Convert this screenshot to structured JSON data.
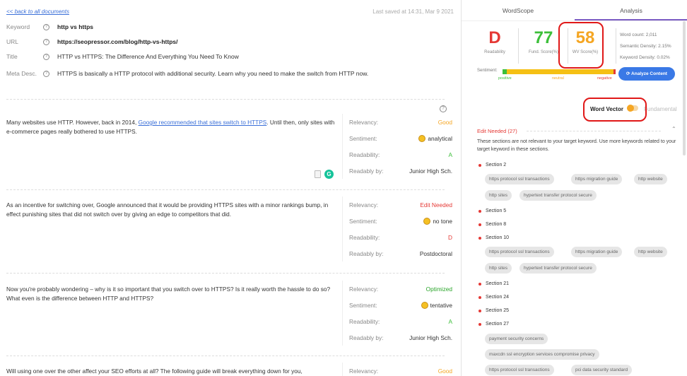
{
  "doc": {
    "back_link": "<< back to all documents",
    "saved": "Last saved at 14:31, Mar 9 2021",
    "meta": [
      {
        "label": "Keyword",
        "value": "http vs https",
        "bold": true
      },
      {
        "label": "URL",
        "value": "https://seopressor.com/blog/http-vs-https/",
        "bold": true
      },
      {
        "label": "Title",
        "value": "HTTP vs HTTPS: The Difference And Everything You Need To Know",
        "bold": false
      },
      {
        "label": "Meta Desc.",
        "value": "HTTPS is basically a HTTP protocol with additional security. Learn why you need to make the switch from HTTP now.",
        "bold": false
      }
    ]
  },
  "stat_labels": {
    "relevancy": "Relevancy:",
    "sentiment": "Sentiment:",
    "readability": "Readability:",
    "readably_by": "Readably by:"
  },
  "paragraphs": [
    {
      "text_before": "Many websites use HTTP. However, back in 2014, ",
      "link": "Google recommended that sites switch to HTTPS",
      "text_after": ". Until then, only sites with e-commerce pages really bothered to use HTTPS.",
      "relevancy": "Good",
      "sentiment": "analytical",
      "readability": "A",
      "readably_by": "Junior High Sch."
    },
    {
      "text_before": "As an incentive for switching over, Google announced that it would be providing HTTPS sites with a minor rankings bump, in effect punishing sites that did not switch over by giving an edge to competitors that did.",
      "link": "",
      "text_after": "",
      "relevancy": "Edit Needed",
      "sentiment": "no tone",
      "readability": "D",
      "readably_by": "Postdoctoral"
    },
    {
      "text_before": "Now you're probably wondering – why is it so important that you switch over to HTTPS? Is it really worth the hassle to do so? What even is the difference between HTTP and HTTPS?",
      "link": "",
      "text_after": "",
      "relevancy": "Optimized",
      "sentiment": "tentative",
      "readability": "A",
      "readably_by": "Junior High Sch."
    },
    {
      "text_before": "Will using one over the other affect your SEO efforts at all? The following guide will break everything down for you,",
      "link": "",
      "text_after": "",
      "relevancy": "Good",
      "sentiment": "",
      "readability": "",
      "readably_by": ""
    }
  ],
  "panel": {
    "tabs": [
      "WordScope",
      "Analysis"
    ],
    "scores": [
      {
        "value": "D",
        "label": "Readability",
        "color": "#e53935"
      },
      {
        "value": "77",
        "label": "Fund. Score(%)",
        "color": "#3cbf3a"
      },
      {
        "value": "58",
        "label": "WV Score(%)",
        "color": "#f5a623"
      }
    ],
    "word_count": "Word count: 2,011",
    "semantic_density": "Semantic Density: 2.15%",
    "keyword_density": "Keyword Density: 0.02%",
    "sentiment_label": "Sentiment:",
    "sentiment_ticks": [
      "positive",
      "neutral",
      "negative"
    ],
    "analyze_button": "Analyze Content",
    "word_vector": "Word Vector",
    "fundamental": "Fundamental",
    "edit_needed": "Edit Needed (27)",
    "description": "These sections are not relevant to your target keyword. Use more keywords related to your target keyword in these sections.",
    "sections": [
      "Section 2",
      "Section 5",
      "Section 8",
      "Section 10",
      "Section 21",
      "Section 24",
      "Section 25",
      "Section 27"
    ],
    "chips": {
      "s2": [
        "https protocol ssl transactions",
        "https migration guide",
        "http website",
        "http sites",
        "hypertext transfer protocol secure"
      ],
      "s10": [
        "https protocol ssl transactions",
        "https migration guide",
        "http website",
        "http sites",
        "hypertext transfer protocol secure"
      ],
      "s27": [
        "payment security concerns",
        "maxcdn ssl encryption services compromise privacy",
        "https protocol ssl transactions",
        "pci data security standard"
      ]
    }
  }
}
